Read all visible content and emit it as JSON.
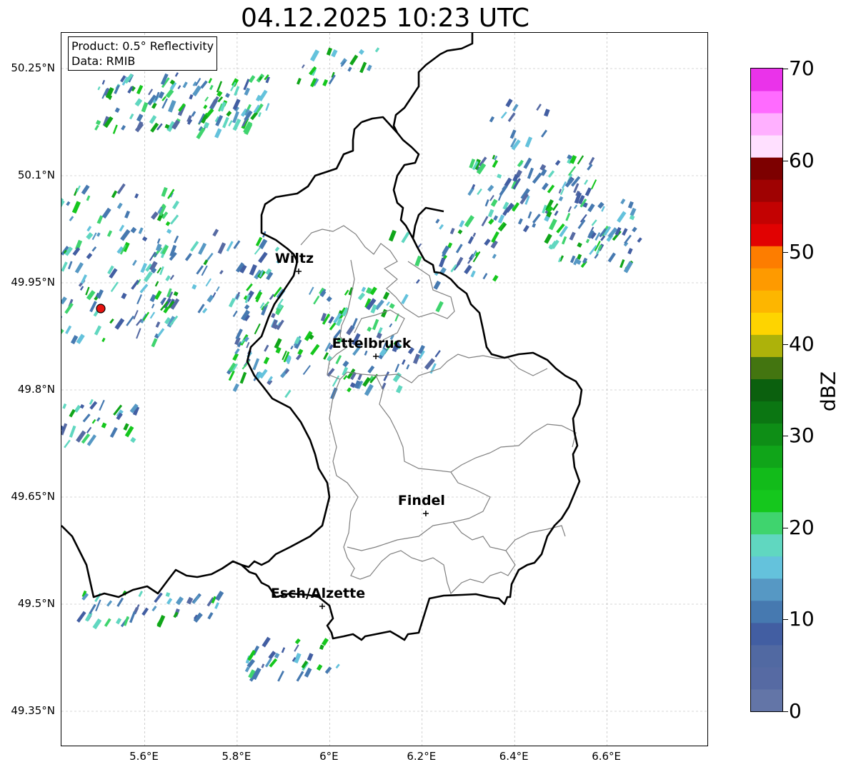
{
  "title": "04.12.2025 10:23 UTC",
  "info": {
    "product": "Product: 0.5° Reflectivity",
    "data": "Data: RMIB"
  },
  "axes": {
    "lat_labels": [
      "50.25°N",
      "50.1°N",
      "49.95°N",
      "49.8°N",
      "49.65°N",
      "49.5°N",
      "49.35°N"
    ],
    "lat_values": [
      50.25,
      50.1,
      49.95,
      49.8,
      49.65,
      49.5,
      49.35
    ],
    "lon_labels": [
      "5.6°E",
      "5.8°E",
      "6°E",
      "6.2°E",
      "6.4°E",
      "6.6°E"
    ],
    "lon_values": [
      5.6,
      5.8,
      6.0,
      6.2,
      6.4,
      6.6
    ],
    "extent": {
      "lon_min": 5.42,
      "lon_max": 6.82,
      "lat_min": 49.3,
      "lat_max": 50.3
    },
    "grid": true
  },
  "cities": [
    {
      "name": "Wiltz",
      "lon": 5.933,
      "lat": 49.966
    },
    {
      "name": "Ettelbruck",
      "lon": 6.1,
      "lat": 49.847
    },
    {
      "name": "Findel",
      "lon": 6.208,
      "lat": 49.627
    },
    {
      "name": "Esch/Alzette",
      "lon": 5.984,
      "lat": 49.497
    }
  ],
  "radar_site": {
    "lon": 5.505,
    "lat": 49.914,
    "color": "#e8130f"
  },
  "colorbar": {
    "label": "dBZ",
    "tick_labels": [
      "0",
      "10",
      "20",
      "30",
      "40",
      "50",
      "60",
      "70"
    ],
    "min": 0,
    "max": 70,
    "colors": [
      "#6375a7",
      "#566aa3",
      "#5169a2",
      "#425ea2",
      "#4679b0",
      "#5698c4",
      "#64c2dc",
      "#60d7c0",
      "#3fd46e",
      "#15c71d",
      "#12bb1a",
      "#10a519",
      "#0e8e16",
      "#0b7612",
      "#0b600e",
      "#437510",
      "#adb20a",
      "#fed400",
      "#fdb600",
      "#fe9a00",
      "#fd7d00",
      "#e10202",
      "#c30202",
      "#9f0202",
      "#7d0000",
      "#ffe0ff",
      "#ffb0ff",
      "#ff6bff",
      "#ea33ea"
    ]
  },
  "colors": {
    "border": "#000000",
    "canton_border": "#808080",
    "grid": "#b0b0b0"
  }
}
